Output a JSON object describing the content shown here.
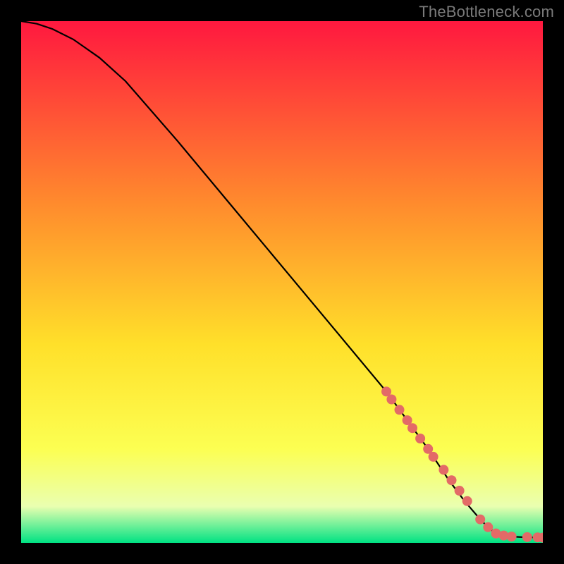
{
  "watermark": "TheBottleneck.com",
  "colors": {
    "grad_top": "#ff183f",
    "grad_mid1": "#ff8b2d",
    "grad_mid2": "#ffe02a",
    "grad_mid3": "#fcff52",
    "grad_low": "#eaffb0",
    "grad_bottom": "#00e283",
    "curve": "#000000",
    "marker": "#e36a67",
    "frame": "#000000"
  },
  "chart_data": {
    "type": "line",
    "title": "",
    "xlabel": "",
    "ylabel": "",
    "xlim": [
      0,
      100
    ],
    "ylim": [
      0,
      100
    ],
    "series": [
      {
        "name": "curve",
        "x": [
          0,
          3,
          6,
          10,
          15,
          20,
          30,
          40,
          50,
          60,
          70,
          78,
          82,
          85,
          88,
          90,
          92,
          94,
          96,
          98,
          100
        ],
        "y": [
          100,
          99.5,
          98.5,
          96.5,
          93,
          88.5,
          77,
          65,
          53,
          41,
          29,
          18,
          12,
          8,
          4.5,
          2.5,
          1.5,
          1.2,
          1.1,
          1.05,
          1
        ]
      }
    ],
    "markers": {
      "name": "highlighted-points",
      "x": [
        70,
        71,
        72.5,
        74,
        75,
        76.5,
        78,
        79,
        81,
        82.5,
        84,
        85.5,
        88,
        89.5,
        91,
        92.5,
        94,
        97,
        99,
        100
      ],
      "y": [
        29,
        27.5,
        25.5,
        23.5,
        22,
        20,
        18,
        16.5,
        14,
        12,
        10,
        8,
        4.5,
        3,
        1.8,
        1.4,
        1.2,
        1.1,
        1.05,
        1
      ]
    }
  }
}
